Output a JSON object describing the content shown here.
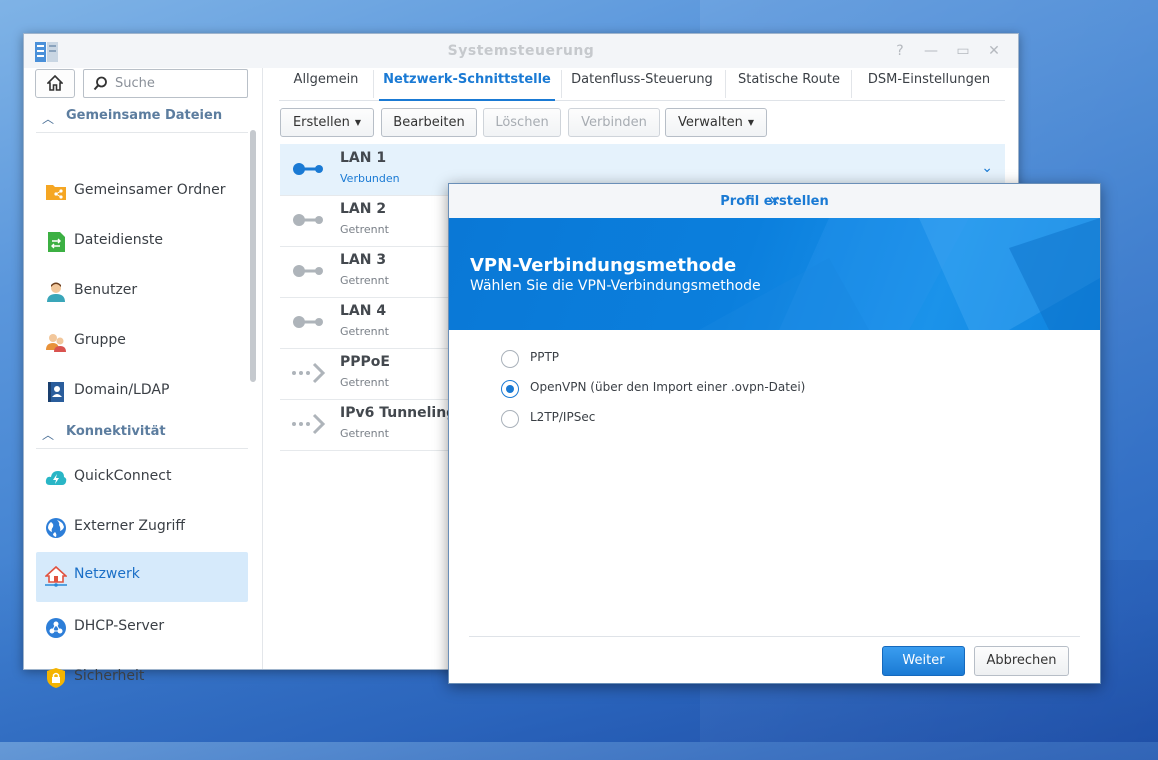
{
  "window": {
    "title": "Systemsteuerung",
    "controls": [
      "help-icon",
      "minimize-icon",
      "maximize-icon",
      "close-icon"
    ]
  },
  "sidebar": {
    "search_placeholder": "Suche",
    "sections": [
      {
        "label": "Gemeinsame Dateien",
        "items": [
          {
            "label": "Gemeinsamer Ordner",
            "icon": "shared-folder-icon"
          },
          {
            "label": "Dateidienste",
            "icon": "file-services-icon"
          },
          {
            "label": "Benutzer",
            "icon": "user-icon"
          },
          {
            "label": "Gruppe",
            "icon": "group-icon"
          },
          {
            "label": "Domain/LDAP",
            "icon": "domain-ldap-icon"
          }
        ]
      },
      {
        "label": "Konnektivität",
        "items": [
          {
            "label": "QuickConnect",
            "icon": "quickconnect-icon"
          },
          {
            "label": "Externer Zugriff",
            "icon": "external-access-icon"
          },
          {
            "label": "Netzwerk",
            "icon": "network-icon",
            "active": true
          },
          {
            "label": "DHCP-Server",
            "icon": "dhcp-server-icon"
          },
          {
            "label": "Sicherheit",
            "icon": "security-icon"
          }
        ]
      }
    ]
  },
  "tabs": [
    {
      "label": "Allgemein"
    },
    {
      "label": "Netzwerk-Schnittstelle",
      "active": true
    },
    {
      "label": "Datenfluss-Steuerung"
    },
    {
      "label": "Statische Route"
    },
    {
      "label": "DSM-Einstellungen"
    }
  ],
  "toolbar": {
    "create": "Erstellen",
    "edit": "Bearbeiten",
    "delete": "Löschen",
    "connect": "Verbinden",
    "manage": "Verwalten"
  },
  "interfaces": [
    {
      "name": "LAN 1",
      "status": "Verbunden",
      "selected": true
    },
    {
      "name": "LAN 2",
      "status": "Getrennt"
    },
    {
      "name": "LAN 3",
      "status": "Getrennt"
    },
    {
      "name": "LAN 4",
      "status": "Getrennt"
    },
    {
      "name": "PPPoE",
      "status": "Getrennt"
    },
    {
      "name": "IPv6 Tunneling",
      "status": "Getrennt"
    }
  ],
  "dialog": {
    "title": "Profil erstellen",
    "heading": "VPN-Verbindungsmethode",
    "subheading": "Wählen Sie die VPN-Verbindungsmethode",
    "options": [
      {
        "label": "PPTP",
        "selected": false
      },
      {
        "label": "OpenVPN (über den Import einer .ovpn-Datei)",
        "selected": true
      },
      {
        "label": "L2TP/IPSec",
        "selected": false
      }
    ],
    "next": "Weiter",
    "cancel": "Abbrechen"
  },
  "colors": {
    "accent": "#1a7ad4",
    "banner": "#0b7fdd",
    "selected_row": "#e5f2fc",
    "active_sidebar": "#d6eafb"
  }
}
